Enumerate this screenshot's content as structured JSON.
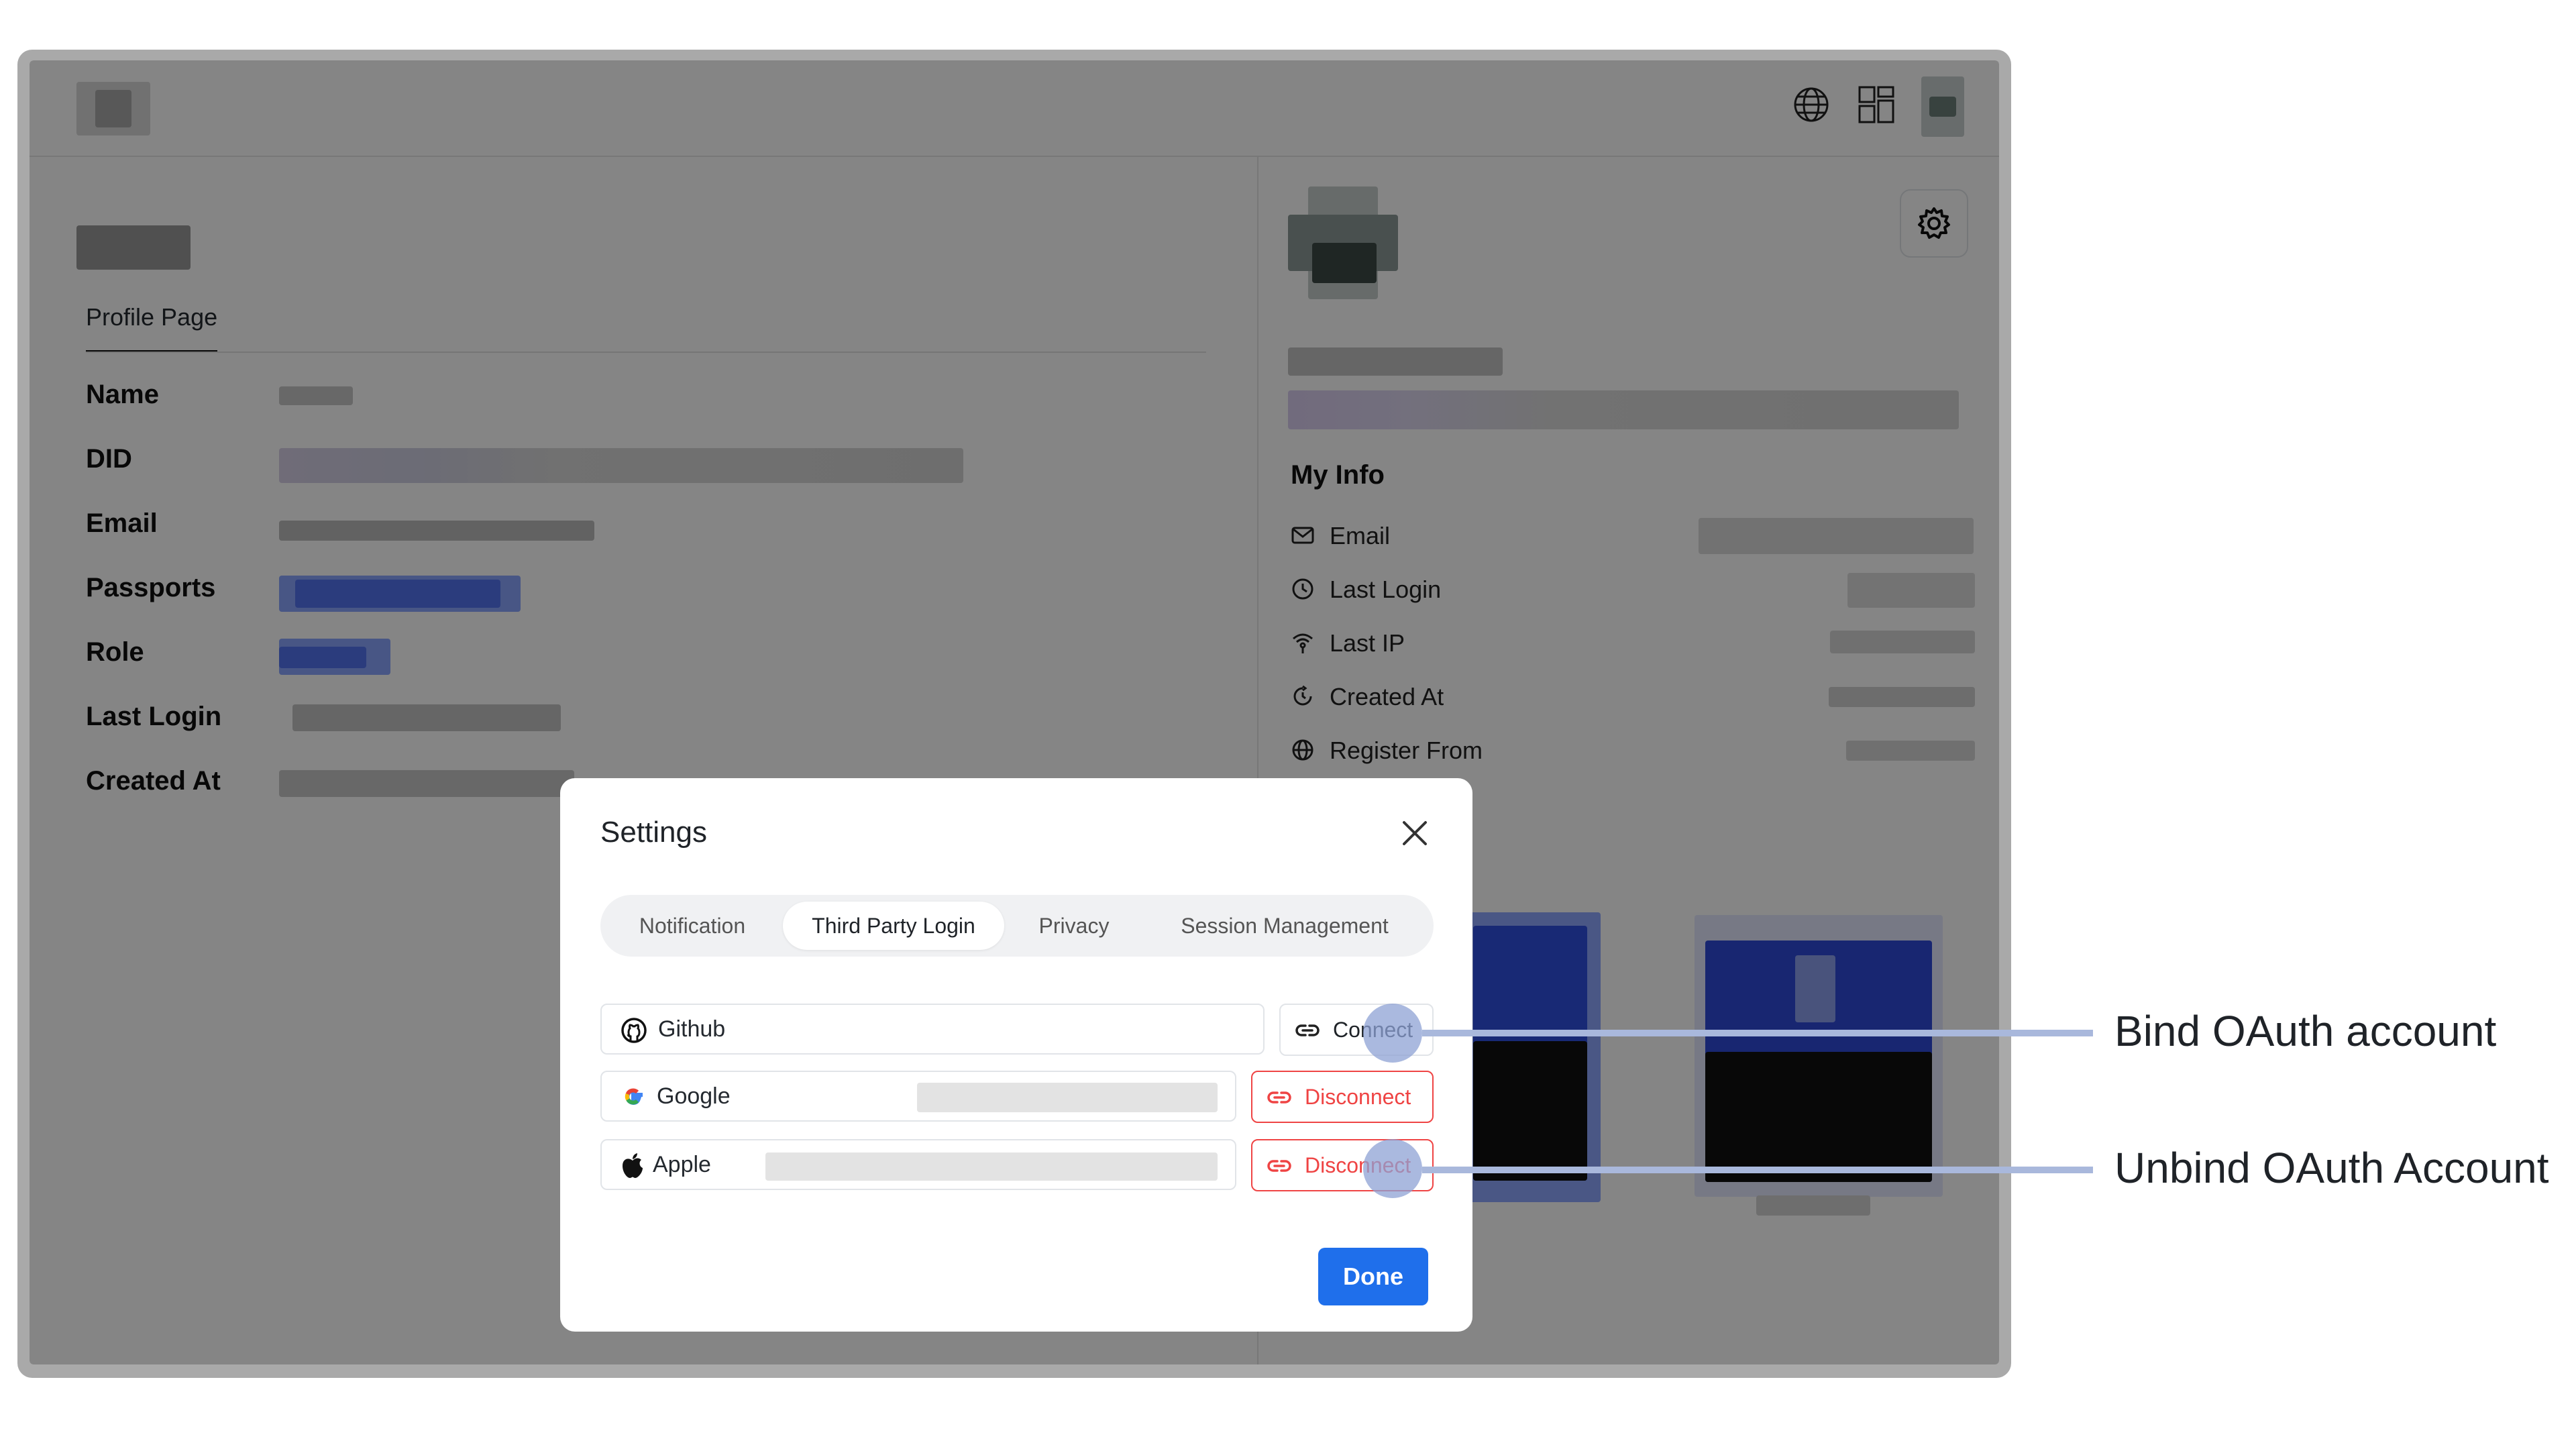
{
  "profile": {
    "tab": "Profile Page",
    "fields": [
      "Name",
      "DID",
      "Email",
      "Passports",
      "Role",
      "Last Login",
      "Created At"
    ]
  },
  "my_info": {
    "title": "My Info",
    "items": [
      {
        "label": "Email",
        "icon": "mail-icon"
      },
      {
        "label": "Last Login",
        "icon": "clock-icon"
      },
      {
        "label": "Last IP",
        "icon": "signal-icon"
      },
      {
        "label": "Created At",
        "icon": "history-icon"
      },
      {
        "label": "Register From",
        "icon": "globe-icon"
      }
    ]
  },
  "settings": {
    "title": "Settings",
    "tabs": [
      "Notification",
      "Third Party Login",
      "Privacy",
      "Session Management"
    ],
    "active_tab": "Third Party Login",
    "providers": [
      {
        "name": "Github",
        "icon": "github-icon",
        "action": "Connect"
      },
      {
        "name": "Google",
        "icon": "google-icon",
        "action": "Disconnect"
      },
      {
        "name": "Apple",
        "icon": "apple-icon",
        "action": "Disconnect"
      }
    ],
    "done": "Done"
  },
  "annotations": {
    "bind": "Bind OAuth account",
    "unbind": "Unbind OAuth Account"
  },
  "colors": {
    "primary": "#1f6feb",
    "danger": "#ef4444",
    "annotation": "#a9b8dc"
  }
}
